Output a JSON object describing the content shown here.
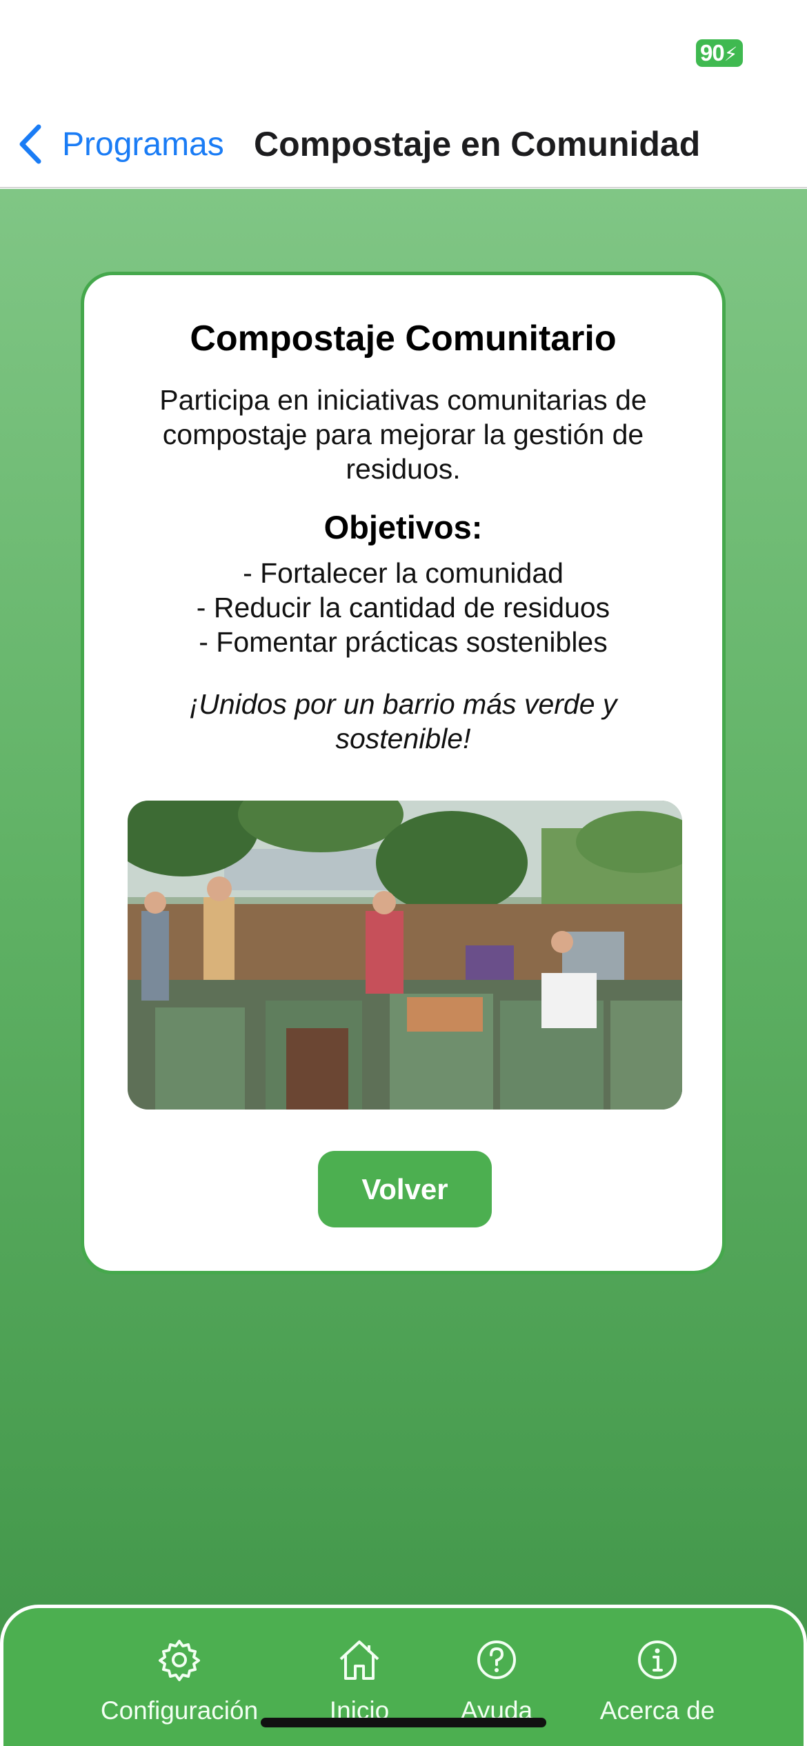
{
  "status_bar": {
    "battery_label": "90"
  },
  "nav": {
    "back_label": "Programas",
    "title": "Compostaje en Comunidad"
  },
  "card": {
    "title": "Compostaje Comunitario",
    "description": "Participa en iniciativas comunitarias de compostaje para mejorar la gestión de residuos.",
    "objectives_title": "Objetivos:",
    "objectives": [
      "- Fortalecer la comunidad",
      "- Reducir la cantidad de residuos",
      "- Fomentar prácticas sostenibles"
    ],
    "slogan": "¡Unidos por un barrio más verde y sostenible!",
    "button_label": "Volver"
  },
  "tabs": [
    {
      "label": "Configuración",
      "icon": "gear-icon"
    },
    {
      "label": "Inicio",
      "icon": "home-icon"
    },
    {
      "label": "Ayuda",
      "icon": "question-circle-icon"
    },
    {
      "label": "Acerca de",
      "icon": "info-circle-icon"
    }
  ],
  "colors": {
    "accent": "#4caf50",
    "link": "#1a7cf5",
    "battery": "#3fb950"
  }
}
